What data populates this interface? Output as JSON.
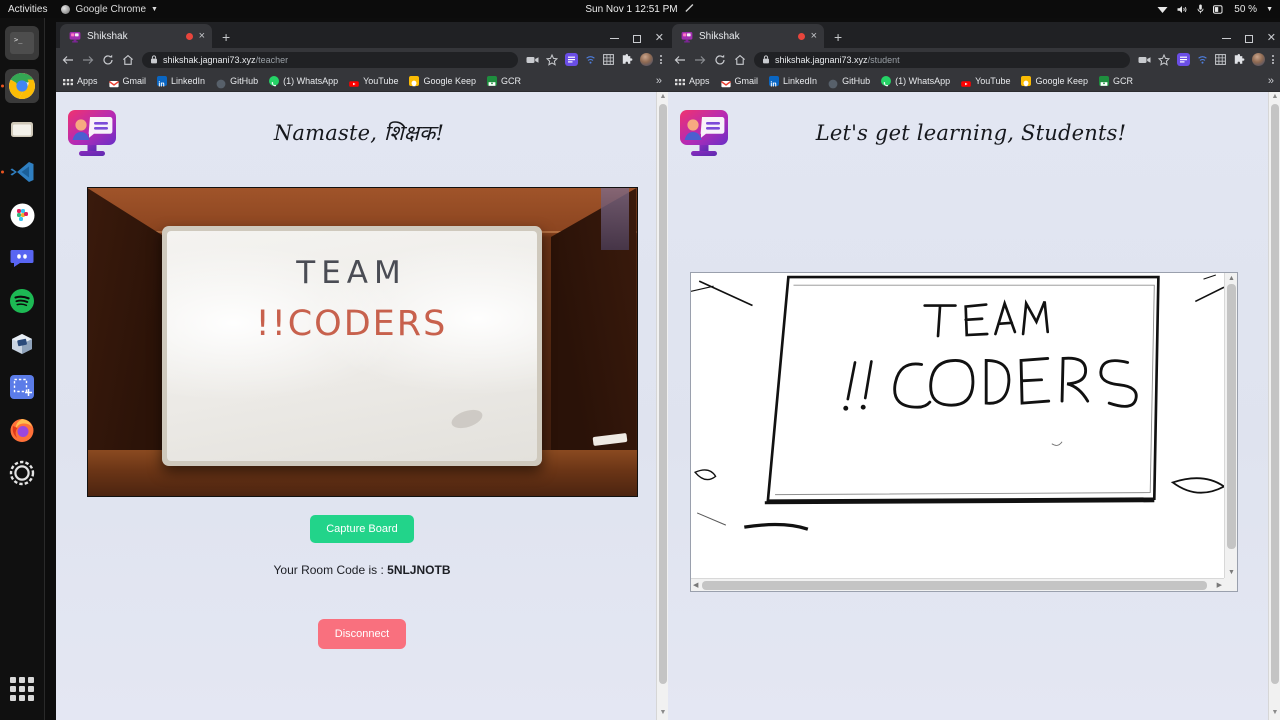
{
  "desktop": {
    "activities": "Activities",
    "app_menu": "Google Chrome",
    "clock": "Sun Nov 1  12:51 PM",
    "battery": "50 %",
    "indicators": [
      "wifi-icon",
      "volume-icon",
      "microphone-icon",
      "battery-icon",
      "screencast-icon"
    ],
    "dock": [
      {
        "name": "terminal",
        "label": "Terminal",
        "running": true
      },
      {
        "name": "google-chrome",
        "label": "Google Chrome",
        "running": true
      },
      {
        "name": "files",
        "label": "Files",
        "running": false
      },
      {
        "name": "visual-studio-code",
        "label": "Visual Studio Code",
        "running": true
      },
      {
        "name": "slack",
        "label": "Slack",
        "running": false
      },
      {
        "name": "discord",
        "label": "Discord",
        "running": false
      },
      {
        "name": "spotify",
        "label": "Spotify",
        "running": false
      },
      {
        "name": "virtualbox",
        "label": "VirtualBox",
        "running": false
      },
      {
        "name": "screenshot",
        "label": "Screenshot",
        "running": false
      },
      {
        "name": "firefox",
        "label": "Firefox",
        "running": false
      },
      {
        "name": "settings",
        "label": "Settings",
        "running": false
      }
    ],
    "show_applications": "Show Applications"
  },
  "colors": {
    "accent_green": "#22d48a",
    "accent_red": "#f9707e",
    "page_background": "#e2e6f2",
    "chrome_dark": "#202124",
    "chrome_toolbar": "#35363a",
    "recording_dot": "#e8453c"
  },
  "bookmarks": [
    {
      "label": "Apps",
      "icon": "apps-grid-icon",
      "color": "#e8eaed"
    },
    {
      "label": "Gmail",
      "icon": "gmail-icon",
      "color": "#ea4335"
    },
    {
      "label": "LinkedIn",
      "icon": "linkedin-icon",
      "color": "#0a66c2"
    },
    {
      "label": "GitHub",
      "icon": "github-icon",
      "color": "#6e6e6e"
    },
    {
      "label": "(1) WhatsApp",
      "icon": "whatsapp-icon",
      "color": "#25d366"
    },
    {
      "label": "YouTube",
      "icon": "youtube-icon",
      "color": "#ff0000"
    },
    {
      "label": "Google Keep",
      "icon": "google-keep-icon",
      "color": "#fbbc04"
    },
    {
      "label": "GCR",
      "icon": "google-classroom-icon",
      "color": "#1e8e3e"
    }
  ],
  "bookmarks_overflow": "»",
  "teacher_window": {
    "tab": {
      "title": "Shikshak",
      "favicon": "shikshak-monitor-icon",
      "recording": true,
      "close": "×"
    },
    "new_tab": "+",
    "url_host": "shikshak.jagnani73.xyz",
    "url_path": "/teacher",
    "page": {
      "greeting": "Namaste, शिक्षक!",
      "logo": "shikshak-monitor-logo",
      "board_photo": {
        "alt": "whiteboard-photo",
        "line1": "TEAM",
        "line2": "!!CODERS"
      },
      "capture_button": "Capture Board",
      "room_code_label": "Your Room Code is : ",
      "room_code": "5NLJNOTB",
      "disconnect_button": "Disconnect"
    }
  },
  "student_window": {
    "tab": {
      "title": "Shikshak",
      "favicon": "shikshak-monitor-icon",
      "recording": true,
      "close": "×"
    },
    "new_tab": "+",
    "url_host": "shikshak.jagnani73.xyz",
    "url_path": "/student",
    "page": {
      "greeting": "Let's get learning, Students!",
      "logo": "shikshak-monitor-logo",
      "processed_board": {
        "alt": "processed-whiteboard-image",
        "line1": "TEAM",
        "line2": "!!CODERS"
      }
    }
  }
}
